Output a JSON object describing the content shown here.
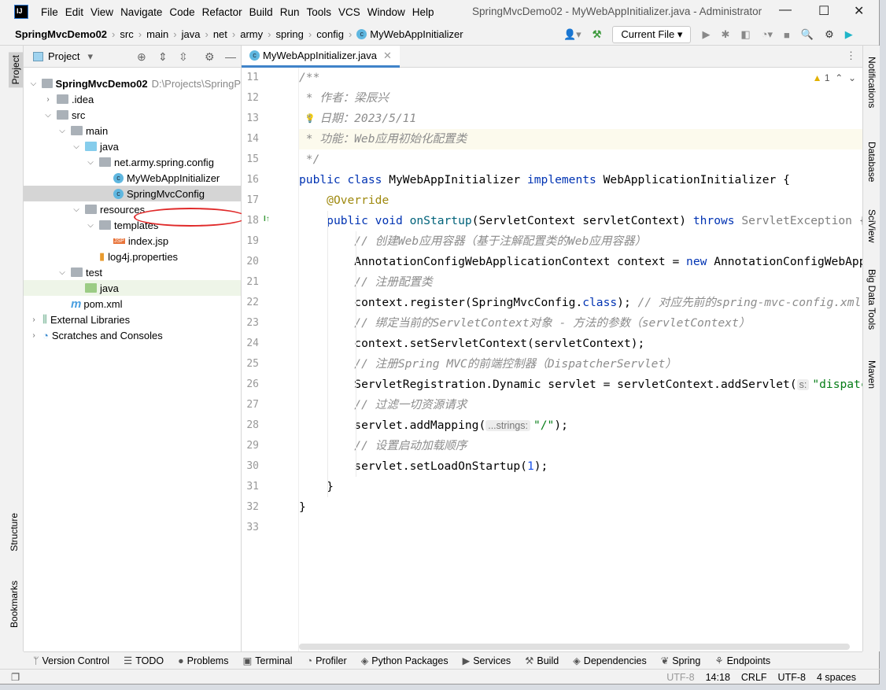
{
  "window": {
    "title": "SpringMvcDemo02 - MyWebAppInitializer.java - Administrator",
    "logo": "IJ"
  },
  "menu": [
    "File",
    "Edit",
    "View",
    "Navigate",
    "Code",
    "Refactor",
    "Build",
    "Run",
    "Tools",
    "VCS",
    "Window",
    "Help"
  ],
  "breadcrumb": [
    "SpringMvcDemo02",
    "src",
    "main",
    "java",
    "net",
    "army",
    "spring",
    "config",
    "MyWebAppInitializer"
  ],
  "toolbar": {
    "run_config": "Current File"
  },
  "left_stripe": [
    "Project",
    "Structure",
    "Bookmarks"
  ],
  "right_stripe": [
    "Notifications",
    "Database",
    "SciView",
    "Big Data Tools",
    "Maven"
  ],
  "project": {
    "title": "Project",
    "tree": [
      {
        "label": "SpringMvcDemo02",
        "extra": "D:\\Projects\\SpringP",
        "depth": 0,
        "chev": "open",
        "icon": "module",
        "bold": true
      },
      {
        "label": ".idea",
        "depth": 1,
        "chev": "closed",
        "icon": "folder"
      },
      {
        "label": "src",
        "depth": 1,
        "chev": "open",
        "icon": "folder"
      },
      {
        "label": "main",
        "depth": 2,
        "chev": "open",
        "icon": "folder"
      },
      {
        "label": "java",
        "depth": 3,
        "chev": "open",
        "icon": "folder-source"
      },
      {
        "label": "net.army.spring.config",
        "depth": 4,
        "chev": "open",
        "icon": "package"
      },
      {
        "label": "MyWebAppInitializer",
        "depth": 5,
        "icon": "class",
        "circled": true
      },
      {
        "label": "SpringMvcConfig",
        "depth": 5,
        "icon": "class",
        "selected": true
      },
      {
        "label": "resources",
        "depth": 3,
        "chev": "open",
        "icon": "folder-resources"
      },
      {
        "label": "templates",
        "depth": 4,
        "chev": "open",
        "icon": "folder"
      },
      {
        "label": "index.jsp",
        "depth": 5,
        "icon": "jsp"
      },
      {
        "label": "log4j.properties",
        "depth": 4,
        "icon": "properties"
      },
      {
        "label": "test",
        "depth": 2,
        "chev": "open",
        "icon": "folder"
      },
      {
        "label": "java",
        "depth": 3,
        "icon": "folder-test",
        "green": true
      },
      {
        "label": "pom.xml",
        "depth": 2,
        "icon": "maven"
      },
      {
        "label": "External Libraries",
        "depth": 0,
        "chev": "closed",
        "icon": "libraries"
      },
      {
        "label": "Scratches and Consoles",
        "depth": 0,
        "chev": "closed",
        "icon": "scratches"
      }
    ]
  },
  "editor": {
    "tab": "MyWebAppInitializer.java",
    "warnings": "1",
    "current_line": 14,
    "lines": [
      {
        "n": 11,
        "tokens": [
          [
            "c",
            "/**"
          ]
        ]
      },
      {
        "n": 12,
        "tokens": [
          [
            "c",
            " * 作者：梁辰兴"
          ]
        ]
      },
      {
        "n": 13,
        "tokens": [
          [
            "c",
            " * 日期：2023/5/11"
          ]
        ]
      },
      {
        "n": 14,
        "tokens": [
          [
            "c",
            " * 功能：Web应用初始化配置类"
          ]
        ]
      },
      {
        "n": 15,
        "tokens": [
          [
            "c",
            " */"
          ]
        ]
      },
      {
        "n": 16,
        "tokens": [
          [
            "k",
            "public class "
          ],
          [
            "t",
            "MyWebAppInitializer "
          ],
          [
            "k",
            "implements "
          ],
          [
            "t",
            "WebApplicationInitializer {"
          ]
        ]
      },
      {
        "n": 17,
        "tokens": [
          [
            "t",
            "    "
          ],
          [
            "a",
            "@Override"
          ]
        ]
      },
      {
        "n": 18,
        "tokens": [
          [
            "t",
            "    "
          ],
          [
            "k",
            "public void "
          ],
          [
            "m",
            "onStartup"
          ],
          [
            "t",
            "(ServletContext servletContext) "
          ],
          [
            "k",
            "throws "
          ],
          [
            "g",
            "ServletException {"
          ]
        ]
      },
      {
        "n": 19,
        "tokens": [
          [
            "t",
            "        "
          ],
          [
            "c",
            "// 创建Web应用容器（基于注解配置类的Web应用容器）"
          ]
        ]
      },
      {
        "n": 20,
        "tokens": [
          [
            "t",
            "        AnnotationConfigWebApplicationContext context = "
          ],
          [
            "k",
            "new "
          ],
          [
            "t",
            "AnnotationConfigWebApplicationContext();"
          ]
        ]
      },
      {
        "n": 21,
        "tokens": [
          [
            "t",
            "        "
          ],
          [
            "c",
            "// 注册配置类"
          ]
        ]
      },
      {
        "n": 22,
        "tokens": [
          [
            "t",
            "        context.register(SpringMvcConfig."
          ],
          [
            "k",
            "class"
          ],
          [
            "t",
            "); "
          ],
          [
            "c",
            "// 对应先前的spring-mvc-config.xml"
          ]
        ]
      },
      {
        "n": 23,
        "tokens": [
          [
            "t",
            "        "
          ],
          [
            "c",
            "// 绑定当前的ServletContext对象 - 方法的参数（servletContext）"
          ]
        ]
      },
      {
        "n": 24,
        "tokens": [
          [
            "t",
            "        context.setServletContext(servletContext);"
          ]
        ]
      },
      {
        "n": 25,
        "tokens": [
          [
            "t",
            "        "
          ],
          [
            "c",
            "// 注册Spring MVC的前端控制器（DispatcherServlet）"
          ]
        ]
      },
      {
        "n": 26,
        "tokens": [
          [
            "t",
            "        ServletRegistration.Dynamic servlet = servletContext.addServlet("
          ],
          [
            "hint",
            "s:"
          ],
          [
            "s",
            "\"dispatcher\""
          ]
        ]
      },
      {
        "n": 27,
        "tokens": [
          [
            "t",
            "        "
          ],
          [
            "c",
            "// 过滤一切资源请求"
          ]
        ]
      },
      {
        "n": 28,
        "tokens": [
          [
            "t",
            "        servlet.addMapping("
          ],
          [
            "hint",
            "...strings:"
          ],
          [
            "s",
            "\"/\""
          ],
          [
            "t",
            ");"
          ]
        ]
      },
      {
        "n": 29,
        "tokens": [
          [
            "t",
            "        "
          ],
          [
            "c",
            "// 设置启动加载顺序"
          ]
        ]
      },
      {
        "n": 30,
        "tokens": [
          [
            "t",
            "        servlet.setLoadOnStartup("
          ],
          [
            "n",
            "1"
          ],
          [
            "t",
            ");"
          ]
        ]
      },
      {
        "n": 31,
        "tokens": [
          [
            "t",
            "    }"
          ]
        ]
      },
      {
        "n": 32,
        "tokens": [
          [
            "t",
            "}"
          ]
        ]
      },
      {
        "n": 33,
        "tokens": []
      }
    ]
  },
  "bottom_tools": [
    "Version Control",
    "TODO",
    "Problems",
    "Terminal",
    "Profiler",
    "Python Packages",
    "Services",
    "Build",
    "Dependencies",
    "Spring",
    "Endpoints"
  ],
  "status": {
    "encoding_hint": "UTF-8",
    "position": "14:18",
    "line_sep": "CRLF",
    "encoding": "UTF-8",
    "indent": "4 spaces"
  }
}
